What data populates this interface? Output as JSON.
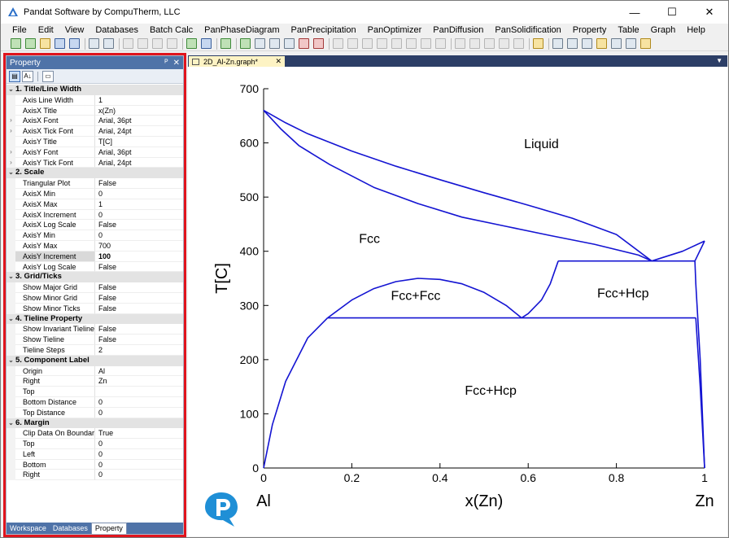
{
  "window": {
    "title": "Pandat Software by CompuTherm, LLC",
    "minimize": "—",
    "maximize": "☐",
    "close": "✕"
  },
  "menu": [
    "File",
    "Edit",
    "View",
    "Databases",
    "Batch Calc",
    "PanPhaseDiagram",
    "PanPrecipitation",
    "PanOptimizer",
    "PanDiffusion",
    "PanSolidification",
    "Property",
    "Table",
    "Graph",
    "Help"
  ],
  "property_panel": {
    "title": "Property",
    "pin": "ᴾ",
    "close": "✕",
    "sections": [
      {
        "label": "1. Title/Line Width",
        "rows": [
          {
            "name": "Axis Line Width",
            "value": "1",
            "expandable": false
          },
          {
            "name": "AxisX Title",
            "value": "x(Zn)",
            "expandable": false
          },
          {
            "name": "AxisX Font",
            "value": "Arial, 36pt",
            "expandable": true
          },
          {
            "name": "AxisX Tick Font",
            "value": "Arial, 24pt",
            "expandable": true
          },
          {
            "name": "AxisY Title",
            "value": "T[C]",
            "expandable": false
          },
          {
            "name": "AxisY Font",
            "value": "Arial, 36pt",
            "expandable": true
          },
          {
            "name": "AxisY Tick Font",
            "value": "Arial, 24pt",
            "expandable": true
          }
        ]
      },
      {
        "label": "2. Scale",
        "rows": [
          {
            "name": "Triangular Plot",
            "value": "False",
            "expandable": false
          },
          {
            "name": "AxisX Min",
            "value": "0",
            "expandable": false
          },
          {
            "name": "AxisX Max",
            "value": "1",
            "expandable": false
          },
          {
            "name": "AxisX Increment",
            "value": "0",
            "expandable": false
          },
          {
            "name": "AxisX Log Scale",
            "value": "False",
            "expandable": false
          },
          {
            "name": "AxisY Min",
            "value": "0",
            "expandable": false
          },
          {
            "name": "AxisY Max",
            "value": "700",
            "expandable": false
          },
          {
            "name": "AxisY Increment",
            "value": "100",
            "expandable": false,
            "selected": true
          },
          {
            "name": "AxisY Log Scale",
            "value": "False",
            "expandable": false
          }
        ]
      },
      {
        "label": "3. Grid/Ticks",
        "rows": [
          {
            "name": "Show Major Grid",
            "value": "False",
            "expandable": false
          },
          {
            "name": "Show Minor Grid",
            "value": "False",
            "expandable": false
          },
          {
            "name": "Show Minor Ticks",
            "value": "False",
            "expandable": false
          }
        ]
      },
      {
        "label": "4. Tieline Property",
        "rows": [
          {
            "name": "Show Invariant Tieline",
            "value": "False",
            "expandable": false
          },
          {
            "name": "Show Tieline",
            "value": "False",
            "expandable": false
          },
          {
            "name": "Tieline Steps",
            "value": "2",
            "expandable": false
          }
        ]
      },
      {
        "label": "5. Component Label",
        "rows": [
          {
            "name": "Origin",
            "value": "Al",
            "expandable": false
          },
          {
            "name": "Right",
            "value": "Zn",
            "expandable": false
          },
          {
            "name": "Top",
            "value": "",
            "expandable": false
          },
          {
            "name": "Bottom Distance",
            "value": "0",
            "expandable": false
          },
          {
            "name": "Top Distance",
            "value": "0",
            "expandable": false
          }
        ]
      },
      {
        "label": "6. Margin",
        "rows": [
          {
            "name": "Clip Data On Boundary",
            "value": "True",
            "expandable": false
          },
          {
            "name": "Top",
            "value": "0",
            "expandable": false
          },
          {
            "name": "Left",
            "value": "0",
            "expandable": false
          },
          {
            "name": "Bottom",
            "value": "0",
            "expandable": false
          },
          {
            "name": "Right",
            "value": "0",
            "expandable": false
          }
        ]
      }
    ],
    "bottom_tabs": [
      {
        "label": "Workspace",
        "active": false
      },
      {
        "label": "Databases",
        "active": false
      },
      {
        "label": "Property",
        "active": true
      }
    ]
  },
  "document": {
    "tab_label": "2D_Al-Zn.graph*",
    "tab_close": "✕",
    "tab_menu": "▼"
  },
  "chart_data": {
    "type": "line",
    "title": "",
    "xlabel": "x(Zn)",
    "ylabel": "T[C]",
    "xlim": [
      0,
      1
    ],
    "ylim": [
      0,
      700
    ],
    "xticks": [
      0,
      0.2,
      0.4,
      0.6,
      0.8,
      1
    ],
    "yticks": [
      0,
      100,
      200,
      300,
      400,
      500,
      600,
      700
    ],
    "x_tick_labels": [
      "0",
      "0.2",
      "0.4",
      "0.6",
      "0.8",
      "1"
    ],
    "y_tick_labels": [
      "0",
      "100",
      "200",
      "300",
      "400",
      "500",
      "600",
      "700"
    ],
    "origin_label": "Al",
    "right_label": "Zn",
    "grid": false,
    "line_color": "#1414d2",
    "phase_labels": [
      {
        "text": "Liquid",
        "x": 0.63,
        "y": 590
      },
      {
        "text": "Fcc",
        "x": 0.24,
        "y": 415
      },
      {
        "text": "Fcc+Fcc",
        "x": 0.345,
        "y": 310
      },
      {
        "text": "Fcc+Hcp",
        "x": 0.815,
        "y": 315
      },
      {
        "text": "Fcc+Hcp",
        "x": 0.515,
        "y": 135
      }
    ],
    "series": [
      {
        "x": [
          0,
          0.05,
          0.1,
          0.2,
          0.3,
          0.4,
          0.5,
          0.6,
          0.7,
          0.8,
          0.88,
          0.95,
          1
        ],
        "y": [
          660,
          637,
          617,
          585,
          557,
          532,
          508,
          485,
          461,
          431,
          382,
          400,
          419
        ]
      },
      {
        "x": [
          0,
          0.04,
          0.08,
          0.15,
          0.25,
          0.35,
          0.45,
          0.55,
          0.65,
          0.75,
          0.85,
          0.88
        ],
        "y": [
          660,
          625,
          595,
          560,
          518,
          488,
          463,
          446,
          429,
          413,
          393,
          382
        ]
      },
      {
        "x": [
          0.668,
          0.978
        ],
        "y": [
          382,
          382
        ]
      },
      {
        "x": [
          0.978,
          0.98,
          0.99,
          1
        ],
        "y": [
          382,
          340,
          200,
          0
        ]
      },
      {
        "x": [
          0.978,
          1
        ],
        "y": [
          382,
          419
        ]
      },
      {
        "x": [
          0.668,
          0.65,
          0.63,
          0.6,
          0.585
        ],
        "y": [
          382,
          340,
          310,
          285,
          277
        ]
      },
      {
        "x": [
          0.585,
          0.98
        ],
        "y": [
          277,
          277
        ]
      },
      {
        "x": [
          0.98,
          0.99,
          1
        ],
        "y": [
          277,
          150,
          0
        ]
      },
      {
        "x": [
          0.145,
          0.2,
          0.25,
          0.3,
          0.35,
          0.4,
          0.45,
          0.5,
          0.55,
          0.585
        ],
        "y": [
          277,
          310,
          331,
          344,
          350,
          348,
          340,
          324,
          300,
          277
        ]
      },
      {
        "x": [
          0.145,
          0.585
        ],
        "y": [
          277,
          277
        ]
      },
      {
        "x": [
          0.145,
          0.1,
          0.05,
          0.02,
          0.005,
          0
        ],
        "y": [
          277,
          240,
          160,
          80,
          20,
          0
        ]
      }
    ]
  }
}
